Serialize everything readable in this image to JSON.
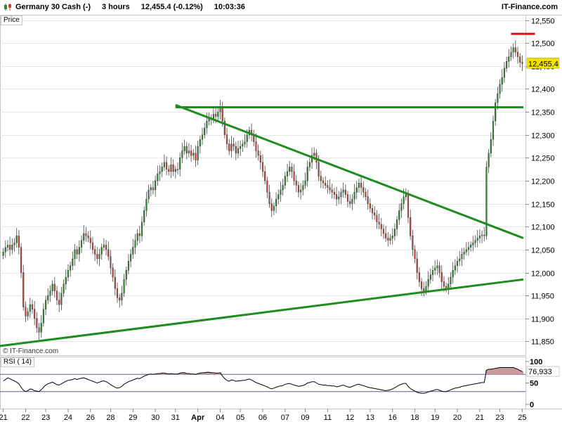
{
  "header": {
    "instrument": "Germany 30 Cash (-)",
    "timeframe": "3 hours",
    "quote": "12,455.4 (-0.12%)",
    "time": "10:03:36",
    "brand": "IT-Finance.com"
  },
  "panel_labels": {
    "price": "Price",
    "rsi": "RSI ( 14)",
    "watermark": "© IT-Finance.com"
  },
  "colors": {
    "up_candle": "#2e8b2e",
    "down_candle": "#c8443c",
    "trendline": "#1e8c1e",
    "resistance_marker": "#e01010",
    "rsi_line": "#000000",
    "rsi_guide": "#5c5c9a",
    "rsi_overbought_fill": "#c99a9a",
    "last_price_bg": "#f2e000"
  },
  "chart_data": [
    {
      "type": "candlestick",
      "x_ticks": [
        "21",
        "22",
        "23",
        "24",
        "26",
        "28",
        "29",
        "30",
        "31",
        "Apr",
        "04",
        "05",
        "06",
        "07",
        "09",
        "11",
        "12",
        "13",
        "16",
        "18",
        "19",
        "20",
        "21",
        "23",
        "25"
      ],
      "y_ticks": [
        "12,550",
        "12,500",
        "12,450",
        "12,400",
        "12,350",
        "12,300",
        "12,250",
        "12,200",
        "12,150",
        "12,100",
        "12,050",
        "12,000",
        "11,950",
        "11,900",
        "11,850"
      ],
      "ylim": [
        11820,
        12560
      ],
      "last_price": "12,455.4",
      "trendlines": [
        {
          "name": "horizontal resistance",
          "from": [
            "31",
            "12,360"
          ],
          "to": [
            "25",
            "12,360"
          ]
        },
        {
          "name": "descending resistance",
          "from": [
            "31",
            "12,365"
          ],
          "to": [
            "25",
            "12,075"
          ]
        },
        {
          "name": "ascending support",
          "from": [
            "21",
            "11,840"
          ],
          "to": [
            "25",
            "11,985"
          ]
        },
        {
          "name": "target marker",
          "from": [
            "25",
            "12,520"
          ],
          "to": [
            "25",
            "12,520"
          ]
        }
      ],
      "series": [
        {
          "values": [
            12045,
            12055,
            12060,
            12050,
            12060,
            12065,
            12080,
            12055,
            12000,
            11925,
            11905,
            11915,
            11930,
            11920,
            11900,
            11880,
            11870,
            11890,
            11920,
            11940,
            11950,
            11960,
            11975,
            11960,
            11940,
            11930,
            11955,
            11975,
            11990,
            12005,
            12015,
            12030,
            12050,
            12040,
            12055,
            12070,
            12085,
            12080,
            12075,
            12065,
            12050,
            12040,
            12030,
            12040,
            12055,
            12060,
            12050,
            12035,
            12010,
            11990,
            11965,
            11945,
            11940,
            11955,
            11985,
            12005,
            12025,
            12040,
            12055,
            12070,
            12085,
            12080,
            12110,
            12135,
            12160,
            12180,
            12185,
            12180,
            12200,
            12215,
            12220,
            12230,
            12240,
            12225,
            12220,
            12235,
            12220,
            12225,
            12225,
            12250,
            12265,
            12275,
            12260,
            12265,
            12255,
            12260,
            12245,
            12275,
            12290,
            12300,
            12315,
            12330,
            12335,
            12335,
            12345,
            12340,
            12350,
            12360,
            12330,
            12300,
            12280,
            12265,
            12280,
            12275,
            12260,
            12270,
            12275,
            12280,
            12285,
            12300,
            12310,
            12300,
            12285,
            12265,
            12255,
            12240,
            12220,
            12200,
            12175,
            12150,
            12135,
            12145,
            12160,
            12170,
            12180,
            12190,
            12210,
            12220,
            12230,
            12220,
            12200,
            12190,
            12175,
            12180,
            12190,
            12200,
            12230,
            12240,
            12255,
            12260,
            12240,
            12210,
            12200,
            12195,
            12190,
            12185,
            12180,
            12175,
            12170,
            12160,
            12165,
            12175,
            12180,
            12170,
            12155,
            12150,
            12160,
            12175,
            12185,
            12195,
            12185,
            12175,
            12165,
            12150,
            12140,
            12130,
            12125,
            12110,
            12105,
            12095,
            12085,
            12075,
            12070,
            12075,
            12080,
            12095,
            12115,
            12135,
            12150,
            12165,
            12170,
            12120,
            12080,
            12050,
            12030,
            12000,
            11980,
            11965,
            11960,
            11970,
            11985,
            11995,
            12005,
            12010,
            12015,
            12000,
            11980,
            11970,
            11965,
            11975,
            11990,
            12005,
            12015,
            12025,
            12030,
            12040,
            12045,
            12050,
            12055,
            12060,
            12065,
            12070,
            12075,
            12080,
            12082,
            12080,
            12230,
            12260,
            12290,
            12330,
            12370,
            12390,
            12410,
            12425,
            12445,
            12460,
            12470,
            12480,
            12490,
            12480,
            12470,
            12458,
            12455
          ]
        }
      ]
    },
    {
      "type": "line",
      "title": "RSI ( 14)",
      "y_ticks": [
        "100",
        "50",
        "0"
      ],
      "ylim": [
        0,
        100
      ],
      "guides": [
        70,
        30
      ],
      "last_value": "76,933",
      "series": [
        {
          "values": [
            55,
            58,
            62,
            60,
            57,
            55,
            52,
            48,
            40,
            33,
            30,
            32,
            36,
            35,
            32,
            31,
            30,
            34,
            40,
            45,
            48,
            50,
            52,
            49,
            46,
            45,
            48,
            51,
            54,
            56,
            57,
            58,
            60,
            58,
            60,
            61,
            62,
            60,
            58,
            56,
            54,
            52,
            50,
            52,
            54,
            55,
            53,
            50,
            46,
            43,
            40,
            38,
            39,
            42,
            47,
            50,
            53,
            55,
            57,
            59,
            61,
            60,
            63,
            66,
            68,
            70,
            71,
            70,
            71,
            72,
            72,
            73,
            73,
            72,
            71,
            72,
            71,
            71,
            71,
            73,
            74,
            74,
            72,
            72,
            71,
            71,
            70,
            72,
            73,
            74,
            74,
            75,
            75,
            74,
            74,
            73,
            73,
            74,
            66,
            60,
            56,
            54,
            57,
            56,
            54,
            55,
            55,
            56,
            56,
            58,
            59,
            57,
            54,
            51,
            49,
            47,
            45,
            43,
            41,
            38,
            36,
            38,
            40,
            42,
            43,
            44,
            47,
            48,
            49,
            47,
            45,
            44,
            42,
            43,
            44,
            46,
            50,
            51,
            53,
            53,
            50,
            47,
            46,
            45,
            45,
            44,
            44,
            43,
            43,
            41,
            42,
            44,
            45,
            43,
            41,
            40,
            42,
            44,
            46,
            47,
            45,
            44,
            42,
            40,
            39,
            38,
            37,
            36,
            35,
            34,
            33,
            32,
            33,
            34,
            36,
            39,
            42,
            45,
            47,
            49,
            49,
            42,
            37,
            34,
            31,
            28,
            27,
            26,
            26,
            27,
            29,
            31,
            32,
            34,
            35,
            33,
            31,
            30,
            30,
            32,
            34,
            36,
            38,
            39,
            40,
            42,
            43,
            44,
            45,
            46,
            47,
            48,
            49,
            50,
            51,
            51,
            80,
            82,
            82,
            83,
            84,
            85,
            86,
            86,
            86,
            86,
            86,
            86,
            86,
            84,
            82,
            79,
            77
          ]
        }
      ]
    }
  ]
}
